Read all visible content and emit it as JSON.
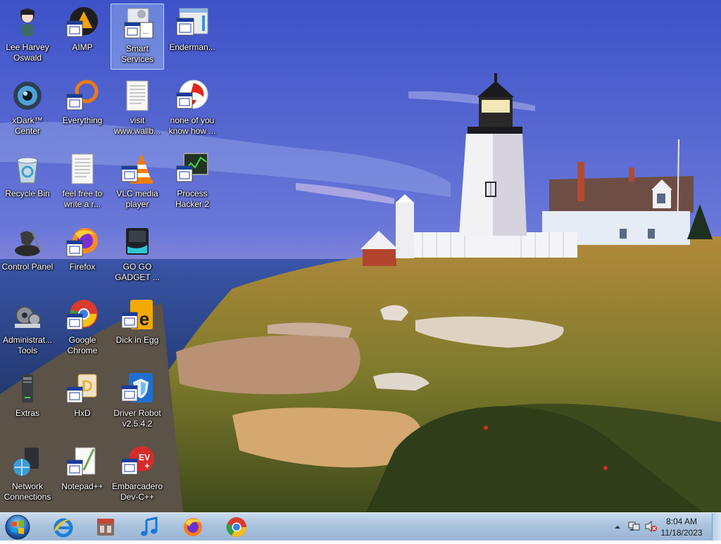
{
  "desktop_icons": [
    {
      "label": "Lee Harvey\nOswald",
      "icon": "person-icon"
    },
    {
      "label": "AIMP",
      "icon": "aimp-icon"
    },
    {
      "label": "Smart\nServices",
      "icon": "smart-services-icon"
    },
    {
      "label": "Enderman...",
      "icon": "app-window-icon"
    },
    {
      "label": "xDark™\nCenter",
      "icon": "xdark-icon"
    },
    {
      "label": "Everything",
      "icon": "everything-icon"
    },
    {
      "label": "visit\nwww.wallb...",
      "icon": "text-document-icon"
    },
    {
      "label": "none of you\nknow how ...",
      "icon": "red-app-icon"
    },
    {
      "label": "Recycle Bin",
      "icon": "recycle-bin-icon"
    },
    {
      "label": "feel free to\nwrite a r...",
      "icon": "text-document-icon"
    },
    {
      "label": "VLC media\nplayer",
      "icon": "vlc-icon"
    },
    {
      "label": "Process\nHacker 2",
      "icon": "process-hacker-icon"
    },
    {
      "label": "Control Panel",
      "icon": "control-panel-icon"
    },
    {
      "label": "Firefox",
      "icon": "firefox-icon"
    },
    {
      "label": "GO GO\nGADGET ...",
      "icon": "gadget-icon"
    },
    {
      "label": "Administrat...\nTools",
      "icon": "admin-tools-icon"
    },
    {
      "label": "Google\nChrome",
      "icon": "chrome-icon"
    },
    {
      "label": "Dick in Egg",
      "icon": "dick-in-egg-icon"
    },
    {
      "label": "Extras",
      "icon": "extras-icon"
    },
    {
      "label": "HxD",
      "icon": "hxd-icon"
    },
    {
      "label": "Driver Robot\nv2.5.4.2",
      "icon": "driver-robot-icon"
    },
    {
      "label": "Network\nConnections",
      "icon": "network-icon"
    },
    {
      "label": "Notepad++",
      "icon": "notepad-plus-icon"
    },
    {
      "label": "Embarcadero\nDev-C++",
      "icon": "devcpp-icon"
    }
  ],
  "taskbar": {
    "pinned": [
      {
        "icon": "internet-explorer-icon"
      },
      {
        "icon": "store-icon"
      },
      {
        "icon": "music-note-icon"
      },
      {
        "icon": "firefox-icon"
      },
      {
        "icon": "chrome-icon"
      }
    ],
    "clock": {
      "time": "8:04 AM",
      "date": "11/18/2023"
    }
  }
}
